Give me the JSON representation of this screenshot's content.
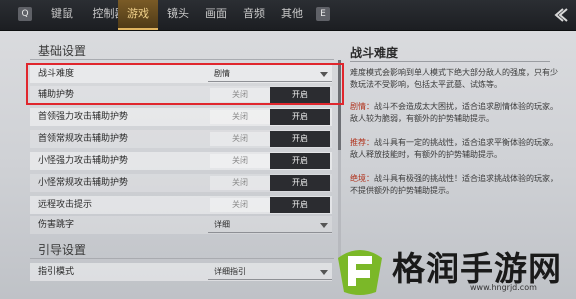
{
  "topbar": {
    "left_key": "Q",
    "right_key": "E",
    "tabs": [
      {
        "label": "键鼠"
      },
      {
        "label": "控制器"
      },
      {
        "label": "游戏"
      },
      {
        "label": "镜头"
      },
      {
        "label": "画面"
      },
      {
        "label": "音频"
      },
      {
        "label": "其他"
      }
    ],
    "active_tab": "游戏"
  },
  "basic": {
    "title": "基础设置",
    "rows": [
      {
        "label": "战斗难度",
        "type": "dropdown",
        "value": "剧情"
      },
      {
        "label": "辅助护势",
        "type": "toggle",
        "off": "关闭",
        "on": "开启",
        "selected": "开启"
      },
      {
        "label": "首领强力攻击辅助护势",
        "type": "toggle",
        "off": "关闭",
        "on": "开启",
        "selected": "开启"
      },
      {
        "label": "首领常规攻击辅助护势",
        "type": "toggle",
        "off": "关闭",
        "on": "开启",
        "selected": "开启"
      },
      {
        "label": "小怪强力攻击辅助护势",
        "type": "toggle",
        "off": "关闭",
        "on": "开启",
        "selected": "开启"
      },
      {
        "label": "小怪常规攻击辅助护势",
        "type": "toggle",
        "off": "关闭",
        "on": "开启",
        "selected": "开启"
      },
      {
        "label": "远程攻击提示",
        "type": "toggle",
        "off": "关闭",
        "on": "开启",
        "selected": "开启"
      },
      {
        "label": "伤害跳字",
        "type": "dropdown",
        "value": "详细"
      }
    ]
  },
  "guide": {
    "title": "引导设置",
    "rows": [
      {
        "label": "指引模式",
        "type": "dropdown",
        "value": "详细指引"
      }
    ]
  },
  "description": {
    "title": "战斗难度",
    "intro": "难度模式会影响到单人模式下绝大部分敌人的强度，只有少数玩法不受影响，包括太平武墓、试炼等。",
    "items": [
      {
        "key": "剧情：",
        "text": "战斗不会造成太大困扰，适合追求剧情体验的玩家。敌人较为脆弱，有额外的护势辅助提示。"
      },
      {
        "key": "推荐：",
        "text": "战斗具有一定的挑战性，适合追求平衡体验的玩家。敌人释放技能时，有额外的护势辅助提示。"
      },
      {
        "key": "绝境：",
        "text": "战斗具有极强的挑战性！适合追求挑战体验的玩家，不提供额外的护势辅助提示。"
      }
    ]
  },
  "watermark": {
    "text": "格润手游网",
    "url": "www.hngrjd.com"
  },
  "colors": {
    "accent": "#e0b460",
    "highlight_border": "#e0262d",
    "toggle_on_bg": "#2b2c30",
    "desc_key": "#b0321c"
  }
}
